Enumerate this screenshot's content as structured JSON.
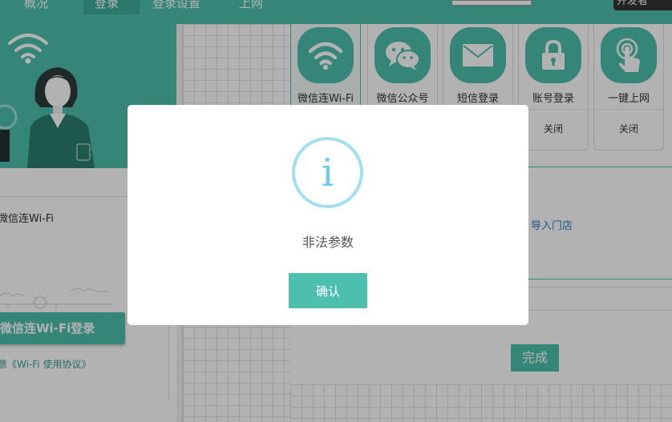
{
  "topbar": {
    "nav_items": [
      "概况",
      "登录",
      "登录设置",
      "上网"
    ],
    "select_value": "",
    "dark_button": "开发者"
  },
  "left_preview": {
    "label": "微信连Wi-Fi",
    "login_button": "微信连Wi-Fi登录",
    "agreement": "意《Wi-Fi 使用协议》"
  },
  "auth_cards": [
    {
      "label": "微信连Wi-Fi",
      "status": "",
      "icon": "wifi-icon"
    },
    {
      "label": "微信公众号",
      "status": "",
      "icon": "wechat-icon"
    },
    {
      "label": "短信登录",
      "status": "",
      "icon": "mail-icon"
    },
    {
      "label": "账号登录",
      "status": "关闭",
      "icon": "lock-icon"
    },
    {
      "label": "一键上网",
      "status": "关闭",
      "icon": "tap-icon"
    }
  ],
  "form": {
    "import_link": "导入门店",
    "done_button": "完成"
  },
  "modal": {
    "icon_glyph": "i",
    "message": "非法参数",
    "confirm_label": "确认"
  },
  "colors": {
    "brand": "#4cbfae",
    "info": "#6ec9ea",
    "link": "#2e77c6"
  }
}
